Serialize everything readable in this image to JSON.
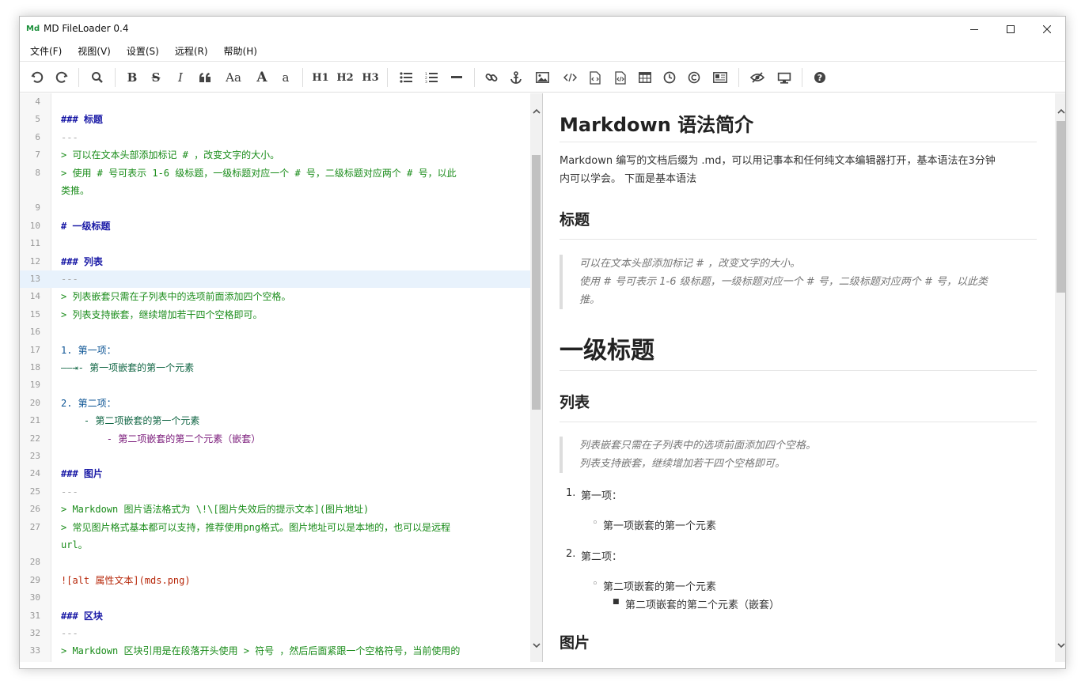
{
  "window": {
    "logo": "Md",
    "title": "MD FileLoader 0.4"
  },
  "menu": [
    "文件(F)",
    "视图(V)",
    "设置(S)",
    "远程(R)",
    "帮助(H)"
  ],
  "toolbar": {
    "h1": "H1",
    "h2": "H2",
    "h3": "H3",
    "case": "Aa",
    "font_larger": "A",
    "font_smaller": "a"
  },
  "editor": {
    "lines": [
      {
        "n": "4",
        "text": "",
        "cls": ""
      },
      {
        "n": "5",
        "text": "### 标题",
        "cls": "c-head"
      },
      {
        "n": "6",
        "text": "---",
        "cls": "c-hr"
      },
      {
        "n": "7",
        "text": "> 可以在文本头部添加标记 # ，改变文字的大小。",
        "cls": "c-quote"
      },
      {
        "n": "8",
        "text": "> 使用 # 号可表示 1-6 级标题，一级标题对应一个 # 号，二级标题对应两个 # 号，以此",
        "cls": "c-quote"
      },
      {
        "n": "",
        "text": "类推。",
        "cls": "c-quote"
      },
      {
        "n": "9",
        "text": "",
        "cls": ""
      },
      {
        "n": "10",
        "text": "# 一级标题",
        "cls": "c-head"
      },
      {
        "n": "11",
        "text": "",
        "cls": ""
      },
      {
        "n": "12",
        "text": "### 列表",
        "cls": "c-head"
      },
      {
        "n": "13",
        "text": "---",
        "cls": "c-hr"
      },
      {
        "n": "14",
        "text": "> 列表嵌套只需在子列表中的选项前面添加四个空格。",
        "cls": "c-quote"
      },
      {
        "n": "15",
        "text": "> 列表支持嵌套，继续增加若干四个空格即可。",
        "cls": "c-quote"
      },
      {
        "n": "16",
        "text": "",
        "cls": ""
      },
      {
        "n": "17",
        "text": "1. 第一项：",
        "cls": "c-num"
      },
      {
        "n": "18",
        "text": "——⇥- 第一项嵌套的第一个元素",
        "cls": "c-list"
      },
      {
        "n": "19",
        "text": "",
        "cls": ""
      },
      {
        "n": "20",
        "text": "2. 第二项：",
        "cls": "c-num"
      },
      {
        "n": "21",
        "text": "    - 第二项嵌套的第一个元素",
        "cls": "c-list2"
      },
      {
        "n": "22",
        "text": "        - 第二项嵌套的第二个元素（嵌套）",
        "cls": "c-list3"
      },
      {
        "n": "23",
        "text": "",
        "cls": ""
      },
      {
        "n": "24",
        "text": "### 图片",
        "cls": "c-head"
      },
      {
        "n": "25",
        "text": "---",
        "cls": "c-hr"
      },
      {
        "n": "26",
        "text": "> Markdown 图片语法格式为 \\!\\[图片失效后的提示文本](图片地址)",
        "cls": "c-quote"
      },
      {
        "n": "27",
        "text": "> 常见图片格式基本都可以支持，推荐使用png格式。图片地址可以是本地的，也可以是远程",
        "cls": "c-quote"
      },
      {
        "n": "",
        "text": "url。",
        "cls": "c-quote"
      },
      {
        "n": "28",
        "text": "",
        "cls": ""
      },
      {
        "n": "29",
        "text": "![alt 属性文本](mds.png)",
        "cls": "c-img"
      },
      {
        "n": "30",
        "text": "",
        "cls": ""
      },
      {
        "n": "31",
        "text": "### 区块",
        "cls": "c-head"
      },
      {
        "n": "32",
        "text": "---",
        "cls": "c-hr"
      },
      {
        "n": "33",
        "text": "> Markdown 区块引用是在段落开头使用 > 符号 ，然后后面紧跟一个空格符号，当前使用的",
        "cls": "c-quote"
      }
    ],
    "highlight_line": "13"
  },
  "preview": {
    "title": "Markdown 语法简介",
    "intro_1": "Markdown 编写的文档后缀为 .md，可以用记事本和任何纯文本编辑器打开，基本语法在3分钟",
    "intro_2": "内可以学会。 下面是基本语法",
    "h_title": "标题",
    "quote1_a": "可以在文本头部添加标记 # ，改变文字的大小。",
    "quote1_b": "使用 # 号可表示 1-6 级标题，一级标题对应一个 # 号，二级标题对应两个 # 号，以此类",
    "quote1_c": "推。",
    "h1_demo": "一级标题",
    "h_list": "列表",
    "quote2_a": "列表嵌套只需在子列表中的选项前面添加四个空格。",
    "quote2_b": "列表支持嵌套，继续增加若干四个空格即可。",
    "ol1": "第一项：",
    "ol1_num": "1.",
    "ol1_sub": "第一项嵌套的第一个元素",
    "ol2": "第二项：",
    "ol2_num": "2.",
    "ol2_sub": "第二项嵌套的第一个元素",
    "ol2_subsub": "第二项嵌套的第二个元素（嵌套）",
    "h_image": "图片"
  }
}
